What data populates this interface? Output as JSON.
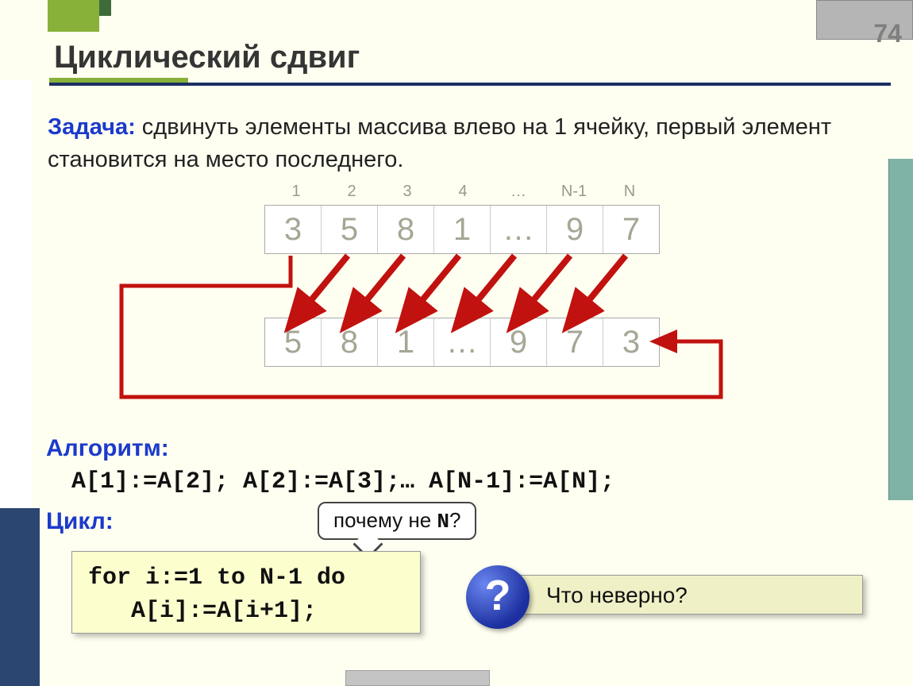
{
  "page_number": "74",
  "title": "Циклический сдвиг",
  "task_label": "Задача:",
  "task_text": " сдвинуть элементы массива влево на 1 ячейку, первый элемент становится на место последнего.",
  "indices": [
    "1",
    "2",
    "3",
    "4",
    "…",
    "N-1",
    "N"
  ],
  "array_before": [
    "3",
    "5",
    "8",
    "1",
    "…",
    "9",
    "7"
  ],
  "array_after": [
    "5",
    "8",
    "1",
    "…",
    "9",
    "7",
    "3"
  ],
  "algorithm_label": "Алгоритм:",
  "algorithm_code": "A[1]:=A[2]; A[2]:=A[3];… A[N-1]:=A[N];",
  "cycle_label": "Цикл:",
  "loop_code": "for i:=1 to N-1 do\n   A[i]:=A[i+1];",
  "callout_pre": "почему не ",
  "callout_code": "N",
  "callout_post": "?",
  "question_mark": "?",
  "question_text": "Что неверно?"
}
